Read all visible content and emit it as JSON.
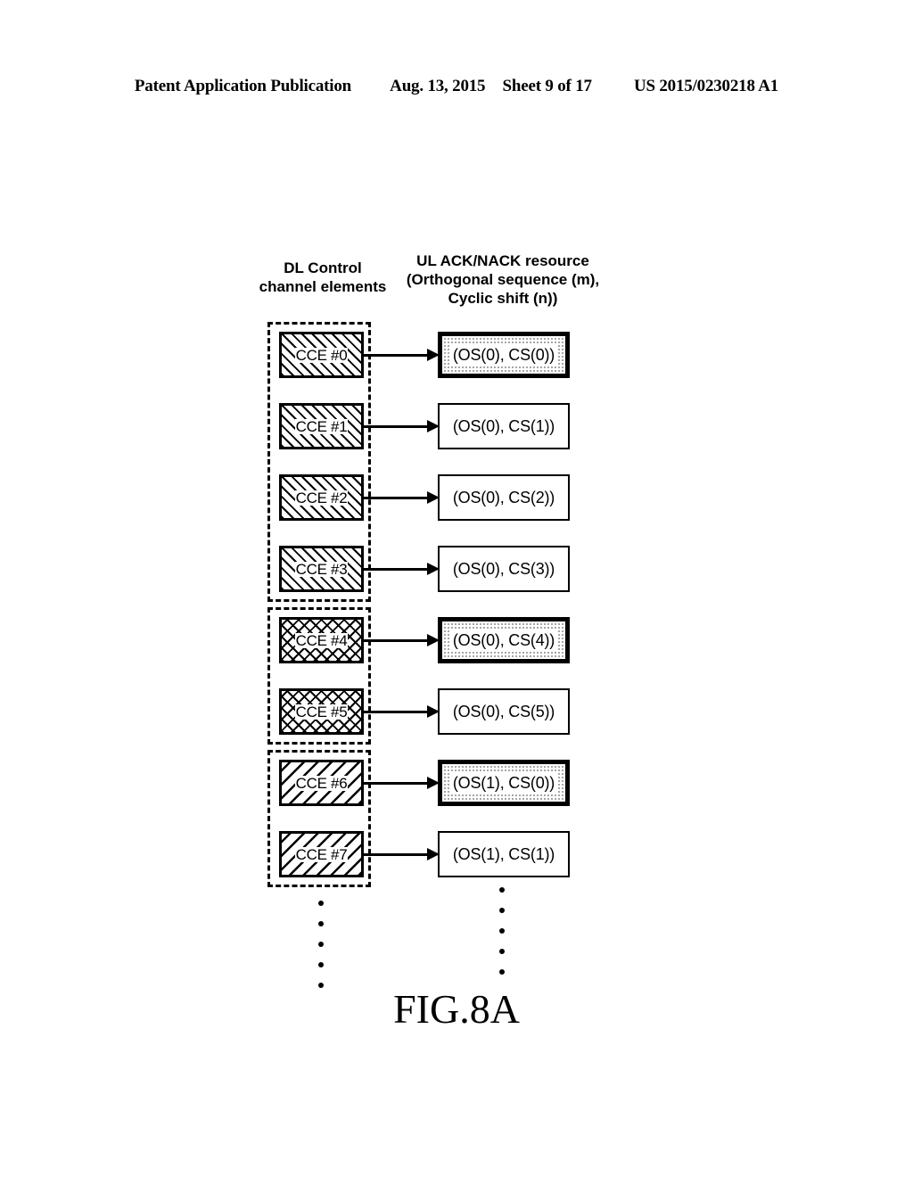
{
  "header": {
    "publication": "Patent Application Publication",
    "date": "Aug. 13, 2015",
    "sheet": "Sheet 9 of 17",
    "patent_number": "US 2015/0230218 A1"
  },
  "figure": {
    "caption": "FIG.8A",
    "headings": {
      "left": "DL Control\nchannel elements",
      "right": "UL ACK/NACK resource\n(Orthogonal sequence (m),\nCyclic shift (n))"
    },
    "rows": [
      {
        "cce": "CCE #0",
        "resource": "(OS(0), CS(0))",
        "hatch": "forward-diagonal",
        "highlighted": true,
        "group": 0
      },
      {
        "cce": "CCE #1",
        "resource": "(OS(0), CS(1))",
        "hatch": "forward-diagonal",
        "highlighted": false,
        "group": 0
      },
      {
        "cce": "CCE #2",
        "resource": "(OS(0), CS(2))",
        "hatch": "forward-diagonal",
        "highlighted": false,
        "group": 0
      },
      {
        "cce": "CCE #3",
        "resource": "(OS(0), CS(3))",
        "hatch": "forward-diagonal",
        "highlighted": false,
        "group": 0
      },
      {
        "cce": "CCE #4",
        "resource": "(OS(0), CS(4))",
        "hatch": "cross-hatch",
        "highlighted": true,
        "group": 1
      },
      {
        "cce": "CCE #5",
        "resource": "(OS(0), CS(5))",
        "hatch": "cross-hatch",
        "highlighted": false,
        "group": 1
      },
      {
        "cce": "CCE #6",
        "resource": "(OS(1), CS(0))",
        "hatch": "back-diagonal",
        "highlighted": true,
        "group": 2
      },
      {
        "cce": "CCE #7",
        "resource": "(OS(1), CS(1))",
        "hatch": "back-diagonal",
        "highlighted": false,
        "group": 2
      }
    ],
    "groups": [
      {
        "label": "cce-group-0-3",
        "first_row": 0,
        "last_row": 3
      },
      {
        "label": "cce-group-4-5",
        "first_row": 4,
        "last_row": 5
      },
      {
        "label": "cce-group-6-7",
        "first_row": 6,
        "last_row": 7
      }
    ],
    "continuation": {
      "left_dots": 5,
      "right_dots": 5
    }
  },
  "colors": {
    "ink": "#000000",
    "paper": "#ffffff"
  }
}
